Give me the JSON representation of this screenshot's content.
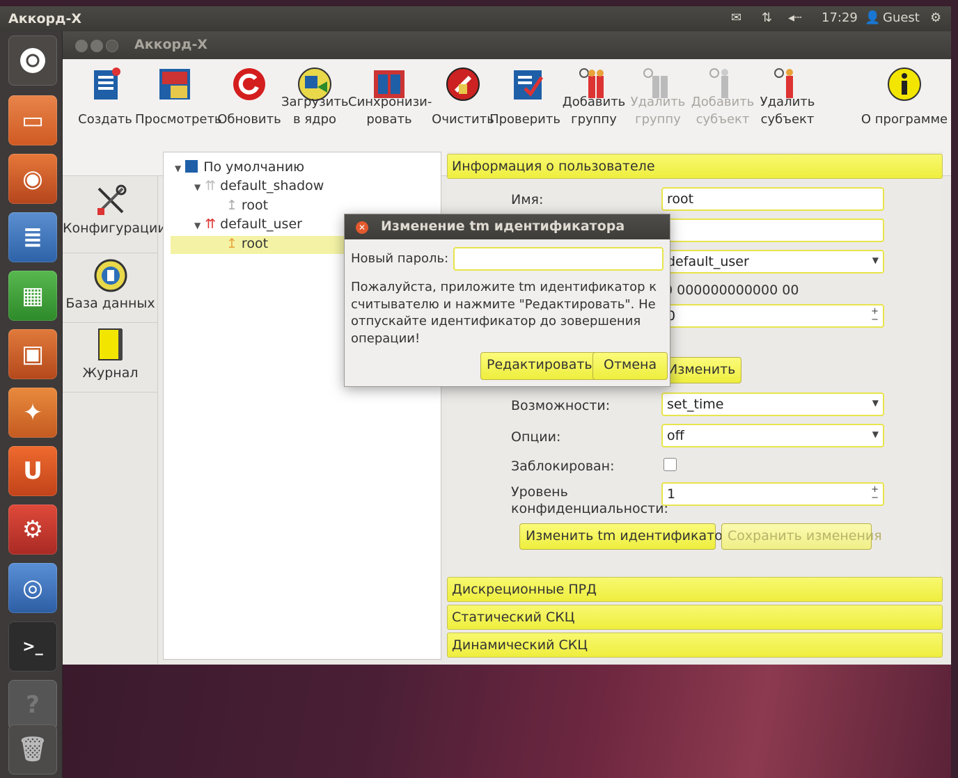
{
  "topbar": {
    "app_title": "Аккорд-X",
    "mail_icon": "mail-icon",
    "network_icon": "network-icon",
    "sound_icon": "sound-icon",
    "time": "17:29",
    "user": "Guest",
    "power_icon": "gear-power-icon"
  },
  "window": {
    "title": "Аккорд-X"
  },
  "toolbar": {
    "items": [
      {
        "label": "Создать",
        "icon": "create-icon"
      },
      {
        "label": "Просмотреть",
        "icon": "view-icon"
      },
      {
        "label": "Обновить",
        "icon": "refresh-icon"
      },
      {
        "label": "Загрузить в ядро",
        "icon": "load-kernel-icon"
      },
      {
        "label": "Синхронизи- ровать",
        "icon": "sync-icon"
      },
      {
        "label": "Очистить",
        "icon": "clear-icon"
      },
      {
        "label": "Проверить",
        "icon": "check-icon"
      },
      {
        "label": "Добавить группу",
        "icon": "add-group-icon"
      },
      {
        "label": "Удалить группу",
        "icon": "remove-group-icon"
      },
      {
        "label": "Добавить субъект",
        "icon": "add-subject-icon"
      },
      {
        "label": "Удалить субъект",
        "icon": "remove-subject-icon"
      },
      {
        "label": "О программе",
        "icon": "info-icon"
      }
    ]
  },
  "leftpanel": {
    "items": [
      {
        "label": "Конфигурации",
        "icon": "config-tools-icon"
      },
      {
        "label": "База данных",
        "icon": "database-icon"
      },
      {
        "label": "Журнал",
        "icon": "journal-icon"
      }
    ]
  },
  "tree": {
    "root": "По умолчанию",
    "group1": "default_shadow",
    "group1_child": "root",
    "group2": "default_user",
    "group2_child": "root"
  },
  "userinfo": {
    "section_title": "Информация о пользователе",
    "name_label": "Имя:",
    "name_value": "root",
    "field2_value": "",
    "group_value": "default_user",
    "id_value": "0 000000000000 00",
    "spin_value": "0",
    "change_button": "Изменить",
    "capabilities_label": "Возможности:",
    "capabilities_value": "set_time",
    "options_label": "Опции:",
    "options_value": "off",
    "locked_label": "Заблокирован:",
    "level_label_1": "Уровень",
    "level_label_2": "конфиденциальности:",
    "level_value": "1",
    "change_tm_button": "Изменить tm идентификатор",
    "save_button": "Сохранить изменения"
  },
  "sections": [
    "Дискреционные ПРД",
    "Статический СКЦ",
    "Динамический СКЦ"
  ],
  "dialog": {
    "title": "Изменение tm идентификатора",
    "password_label": "Новый пароль:",
    "password_value": "",
    "message": "Пожалуйста, приложите tm идентификатор к считывателю и нажмите \"Редактировать\". Не отпускайте идентификатор до зовершения операции!",
    "edit_button": "Редактировать",
    "cancel_button": "Отмена"
  },
  "colors": {
    "accent_yellow": "#eeee3e",
    "launcher_bg": "#3d3a39",
    "titlebar_bg": "#3d3c38"
  }
}
